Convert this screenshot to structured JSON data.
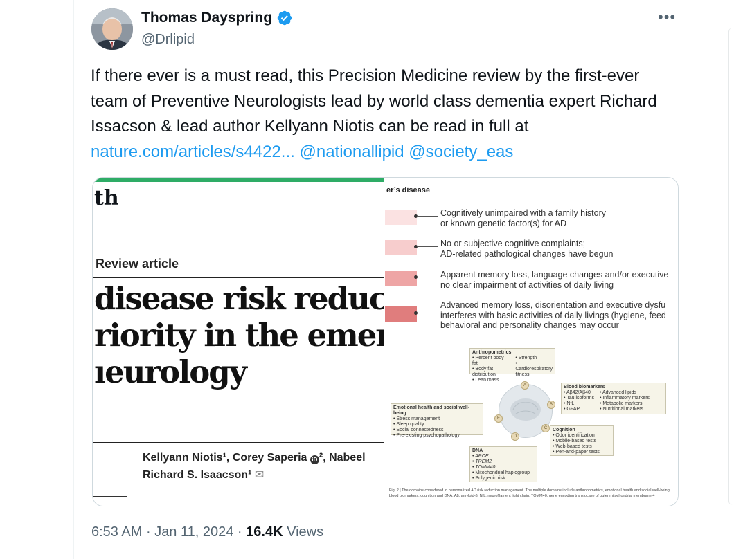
{
  "tweet": {
    "author_name": "Thomas Dayspring",
    "handle": "@Drlipid",
    "more_label": "•••",
    "text_before_links": "If there ever is a must read, this Precision Medicine review by the first-ever team of Preventive Neurologists lead by world class dementia expert Richard Issacson & lead author Kellyann Niotis can be read in full at",
    "link_url": "nature.com/articles/s4422...",
    "mention_1": "@nationallipid",
    "mention_2": "@society_eas",
    "time": "6:53 AM",
    "date": "Jan 11, 2024",
    "views_count": "16.4K",
    "views_label": "Views"
  },
  "colors": {
    "link": "#1d9bf0",
    "verified": "#1d9bf0",
    "accent_bar": "#2eac66"
  },
  "media": {
    "left": {
      "fragment_th": "th",
      "review_label": "Review article",
      "title_lines": [
        "disease risk reducti",
        "riority in the emerg",
        "ıeurology"
      ],
      "authors_line1": "Kellyann Niotis¹, Corey Saperia",
      "authors_line1_end": "², Nabeel",
      "authors_line2": "Richard S. Isaacson¹"
    },
    "right": {
      "heading": "er’s disease",
      "stages": [
        {
          "color": "#fbe2e2",
          "lines": [
            "Cognitively unimpaired with a family history",
            "or known genetic factor(s) for AD"
          ]
        },
        {
          "color": "#f7cdcd",
          "lines": [
            "No or subjective cognitive complaints;",
            "AD-related pathological changes have begun"
          ]
        },
        {
          "color": "#eea5a5",
          "lines": [
            "Apparent memory loss, language changes and/or executive",
            "no clear impairment of activities of daily living"
          ]
        },
        {
          "color": "#e07d7d",
          "lines": [
            "Advanced memory loss, disorientation and executive dysfu",
            "interferes with basic activities of daily livings (hygiene, feed",
            "behavioral and personality changes may occur"
          ]
        }
      ],
      "anthro": {
        "title": "Anthropometrics",
        "col1": [
          "• Percent body fat",
          "• Body fat distribution",
          "• Lean mass"
        ],
        "col2": [
          "• Strength",
          "• Cardiorespiratory",
          "  fitness"
        ]
      },
      "blood": {
        "title": "Blood biomarkers",
        "col1": [
          "• Aβ42/Aβ40",
          "• Tau isoforms",
          "• NfL",
          "• GFAP"
        ],
        "col2": [
          "• Advanced lipids",
          "• Inflammatory markers",
          "• Metabolic markers",
          "• Nutritional markers"
        ]
      },
      "emotional": {
        "title": "Emotional health and social well-being",
        "items": [
          "• Stress management",
          "• Sleep quality",
          "• Social connectedness",
          "• Pre-existing psychopathology"
        ]
      },
      "cognition": {
        "title": "Cognition",
        "items": [
          "• Odor identification",
          "• Mobile-based tests",
          "• Web-based tests",
          "• Pen-and-paper tests"
        ]
      },
      "dna": {
        "title": "DNA",
        "items": [
          "• APOE",
          "• TREM2",
          "• TOMM40",
          "• Mitochondrial haplogroup",
          "• Polygenic risk"
        ]
      },
      "nodes": [
        "A",
        "B",
        "C",
        "D",
        "E"
      ],
      "caption": "Fig. 2 | The domains considered in personalized AD risk reduction management. The multiple domains include anthropometrics, emotional health and social well-being, blood biomarkers, cognition and DNA. Aβ, amyloid-β; NfL, neurofilament light chain; TOMM40, gene encoding translocase of outer mitochondrial membrane 4"
    }
  }
}
